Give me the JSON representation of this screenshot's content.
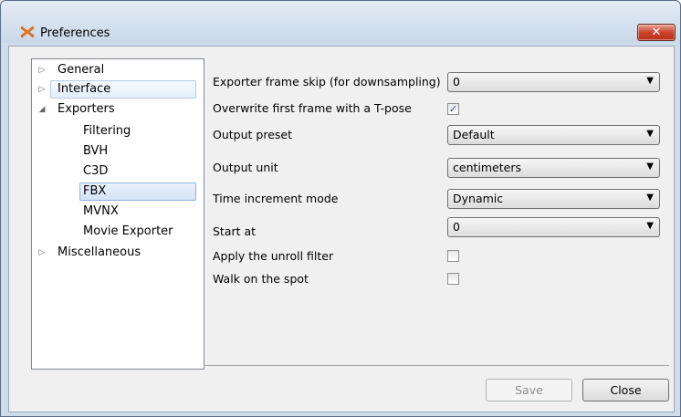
{
  "window": {
    "title": "Preferences",
    "close_glyph": "✕"
  },
  "tree": {
    "items": [
      {
        "label": "General",
        "arrow": "▷"
      },
      {
        "label": "Interface",
        "arrow": "▷"
      },
      {
        "label": "Exporters",
        "arrow": "◢"
      },
      {
        "label": "Filtering"
      },
      {
        "label": "BVH"
      },
      {
        "label": "C3D"
      },
      {
        "label": "FBX"
      },
      {
        "label": "MVNX"
      },
      {
        "label": "Movie Exporter"
      },
      {
        "label": "Miscellaneous",
        "arrow": "▷"
      }
    ],
    "selected": "FBX"
  },
  "settings": {
    "frame_skip": {
      "label": "Exporter frame skip (for downsampling)",
      "value": "0"
    },
    "tpose": {
      "label": "Overwrite first frame with a T-pose",
      "checked": true,
      "mark": "✓"
    },
    "preset": {
      "label": "Output preset",
      "value": "Default"
    },
    "unit": {
      "label": "Output unit",
      "value": "centimeters"
    },
    "time_mode": {
      "label": "Time increment mode",
      "value": "Dynamic"
    },
    "start_at": {
      "label": "Start at",
      "value": "0"
    },
    "unroll": {
      "label": "Apply the unroll filter",
      "checked": false
    },
    "walk": {
      "label": "Walk on the spot",
      "checked": false
    }
  },
  "dropdown_glyph": "▼",
  "buttons": {
    "save": "Save",
    "close": "Close"
  },
  "colors": {
    "selection": "#d3e3f6",
    "close_button": "#c8432c"
  }
}
